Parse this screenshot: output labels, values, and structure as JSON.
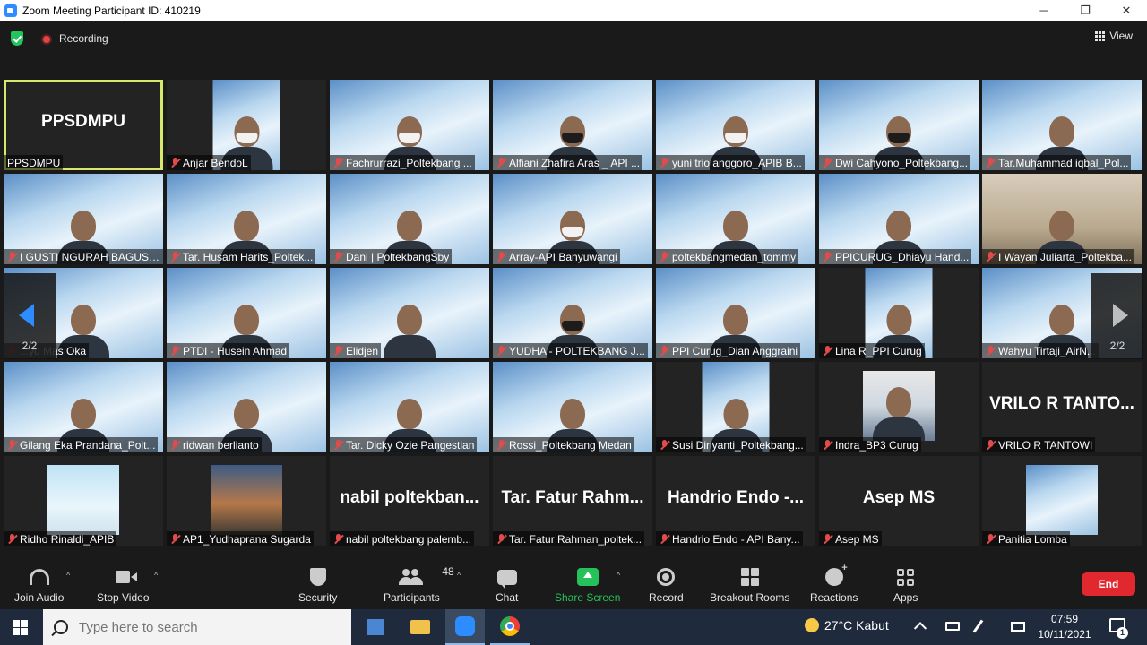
{
  "window": {
    "title": "Zoom Meeting Participant ID: 410219",
    "minimize": "─",
    "restore": "❐",
    "close": "✕"
  },
  "topbar": {
    "recording_label": "Recording",
    "view_label": "View"
  },
  "gallery": {
    "page_indicator_left": "2/2",
    "page_indicator_right": "2/2",
    "tiles": [
      {
        "name": "PPSDMPU",
        "big_name": "PPSDMPU",
        "type": "name",
        "active": true,
        "muted": false
      },
      {
        "name": "Anjar BendoL",
        "type": "video",
        "bg": "bg-challenge",
        "style": "small",
        "mask": "light"
      },
      {
        "name": "Fachrurrazi_Poltekbang ...",
        "type": "video",
        "bg": "bg-challenge",
        "style": "full",
        "mask": "light"
      },
      {
        "name": "Alfiani Zhafira Aras _ API ...",
        "type": "video",
        "bg": "bg-challenge",
        "style": "full",
        "mask": "dark"
      },
      {
        "name": "yuni trio anggoro_APIB B...",
        "type": "video",
        "bg": "bg-challenge",
        "style": "full",
        "mask": "light"
      },
      {
        "name": "Dwi Cahyono_Poltekbang...",
        "type": "video",
        "bg": "bg-challenge",
        "style": "full",
        "mask": "dark"
      },
      {
        "name": "Tar.Muhammad iqbal_Pol...",
        "type": "video",
        "bg": "bg-challenge",
        "style": "full",
        "mask": "none"
      },
      {
        "name": "I GUSTI NGURAH BAGUS ...",
        "type": "video",
        "bg": "bg-challenge",
        "style": "full",
        "mask": "none"
      },
      {
        "name": "Tar. Husam Harits_Poltek...",
        "type": "video",
        "bg": "bg-challenge",
        "style": "full",
        "mask": "none"
      },
      {
        "name": "Dani | PoltekbangSby",
        "type": "video",
        "bg": "bg-challenge",
        "style": "full",
        "mask": "none"
      },
      {
        "name": "Array-API Banyuwangi",
        "type": "video",
        "bg": "bg-challenge",
        "style": "full",
        "mask": "light"
      },
      {
        "name": "poltekbangmedan_tommy",
        "type": "video",
        "bg": "bg-challenge",
        "style": "full",
        "mask": "none"
      },
      {
        "name": "PPICURUG_Dhiayu Hand...",
        "type": "video",
        "bg": "bg-challenge",
        "style": "full",
        "mask": "none"
      },
      {
        "name": "I Wayan Juliarta_Poltekba...",
        "type": "video",
        "bg": "bg-room",
        "style": "full",
        "mask": "none"
      },
      {
        "name": "...yu Mas Oka",
        "type": "video",
        "bg": "bg-challenge",
        "style": "full",
        "mask": "none"
      },
      {
        "name": "PTDI - Husein Ahmad",
        "type": "video",
        "bg": "bg-challenge",
        "style": "full",
        "mask": "none"
      },
      {
        "name": "Elidjen",
        "type": "video",
        "bg": "bg-challenge",
        "style": "full",
        "mask": "none"
      },
      {
        "name": "YUDHA - POLTEKBANG J...",
        "type": "video",
        "bg": "bg-challenge",
        "style": "full",
        "mask": "dark"
      },
      {
        "name": "PPI Curug_Dian Anggraini",
        "type": "video",
        "bg": "bg-challenge",
        "style": "full",
        "mask": "none"
      },
      {
        "name": "Lina R_PPI Curug",
        "type": "video",
        "bg": "bg-challenge",
        "style": "small",
        "mask": "none"
      },
      {
        "name": "Wahyu Tirtaji_AirN...",
        "type": "video",
        "bg": "bg-challenge",
        "style": "full",
        "mask": "none"
      },
      {
        "name": "Gilang Eka Prandana_Polt...",
        "type": "video",
        "bg": "bg-challenge",
        "style": "full",
        "mask": "none"
      },
      {
        "name": "ridwan berlianto",
        "type": "video",
        "bg": "bg-challenge",
        "style": "full",
        "mask": "none"
      },
      {
        "name": "Tar. Dicky Ozie Pangestian",
        "type": "video",
        "bg": "bg-challenge",
        "style": "full",
        "mask": "none"
      },
      {
        "name": "Rossi_Poltekbang Medan",
        "type": "video",
        "bg": "bg-challenge",
        "style": "full",
        "mask": "none"
      },
      {
        "name": "Susi Diriyanti_Poltekbang...",
        "type": "video",
        "bg": "bg-challenge",
        "style": "small",
        "mask": "none"
      },
      {
        "name": "Indra_BP3 Curug",
        "type": "video",
        "bg": "bg-office",
        "style": "mid",
        "mask": "none"
      },
      {
        "name": "VRILO R TANTOWI",
        "big_name": "VRILO R TANTO...",
        "type": "name"
      },
      {
        "name": "Ridho Rinaldi_APIB",
        "type": "image",
        "bg": "bg-plane",
        "style": "mid"
      },
      {
        "name": "AP1_Yudhaprana Sugarda",
        "type": "image",
        "bg": "bg-sunset",
        "style": "mid"
      },
      {
        "name": "nabil poltekbang palemb...",
        "big_name": "nabil poltekban...",
        "type": "name"
      },
      {
        "name": "Tar. Fatur Rahman_poltek...",
        "big_name": "Tar. Fatur Rahm...",
        "type": "name"
      },
      {
        "name": "Handrio Endo - API Bany...",
        "big_name": "Handrio Endo -...",
        "type": "name"
      },
      {
        "name": "Asep MS",
        "big_name": "Asep MS",
        "type": "name"
      },
      {
        "name": "Panitia Lomba",
        "type": "image",
        "bg": "bg-challenge",
        "style": "mid"
      }
    ]
  },
  "toolbar": {
    "join_audio": "Join Audio",
    "stop_video": "Stop Video",
    "security": "Security",
    "participants": "Participants",
    "participants_count": "48",
    "chat": "Chat",
    "share_screen": "Share Screen",
    "record": "Record",
    "breakout_rooms": "Breakout Rooms",
    "reactions": "Reactions",
    "apps": "Apps",
    "end": "End",
    "caret": "^"
  },
  "taskbar": {
    "search_placeholder": "Type here to search",
    "weather": "27°C  Kabut",
    "time": "07:59",
    "date": "10/11/2021",
    "notification_count": "1"
  }
}
